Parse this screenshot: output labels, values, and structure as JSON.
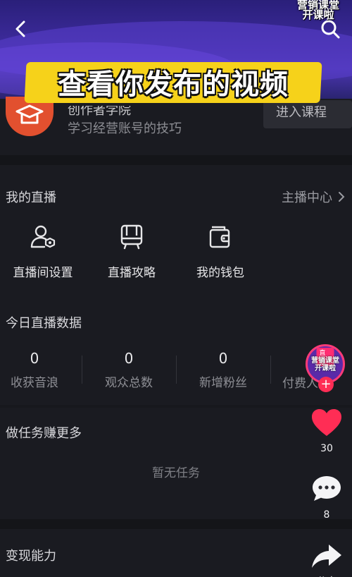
{
  "header": {
    "badge_line1": "营销课堂",
    "badge_line2": "开课啦",
    "caption": "查看你发布的视频"
  },
  "academy": {
    "title": "创作者学院",
    "subtitle": "学习经营账号的技巧",
    "enter_label": "进入课程"
  },
  "live": {
    "section_title": "我的直播",
    "center_link": "主播中心",
    "items": [
      {
        "label": "直播间设置",
        "icon": "user-settings-icon"
      },
      {
        "label": "直播攻略",
        "icon": "guide-board-icon"
      },
      {
        "label": "我的钱包",
        "icon": "wallet-icon"
      }
    ]
  },
  "today": {
    "section_title": "今日直播数据",
    "stats": [
      {
        "value": "0",
        "label": "收获音浪"
      },
      {
        "value": "0",
        "label": "观众总数"
      },
      {
        "value": "0",
        "label": "新增粉丝"
      },
      {
        "value": "",
        "label": "付费人数"
      }
    ]
  },
  "tasks": {
    "section_title": "做任务赚更多",
    "empty_text": "暂无任务"
  },
  "monetize": {
    "section_title": "变现能力"
  },
  "rail": {
    "live_tag": "直播",
    "avatar_line1": "营销课堂",
    "avatar_line2": "开课啦",
    "likes": "30",
    "comments": "8",
    "share_label": "分享",
    "like_color": "#ff2d55"
  }
}
